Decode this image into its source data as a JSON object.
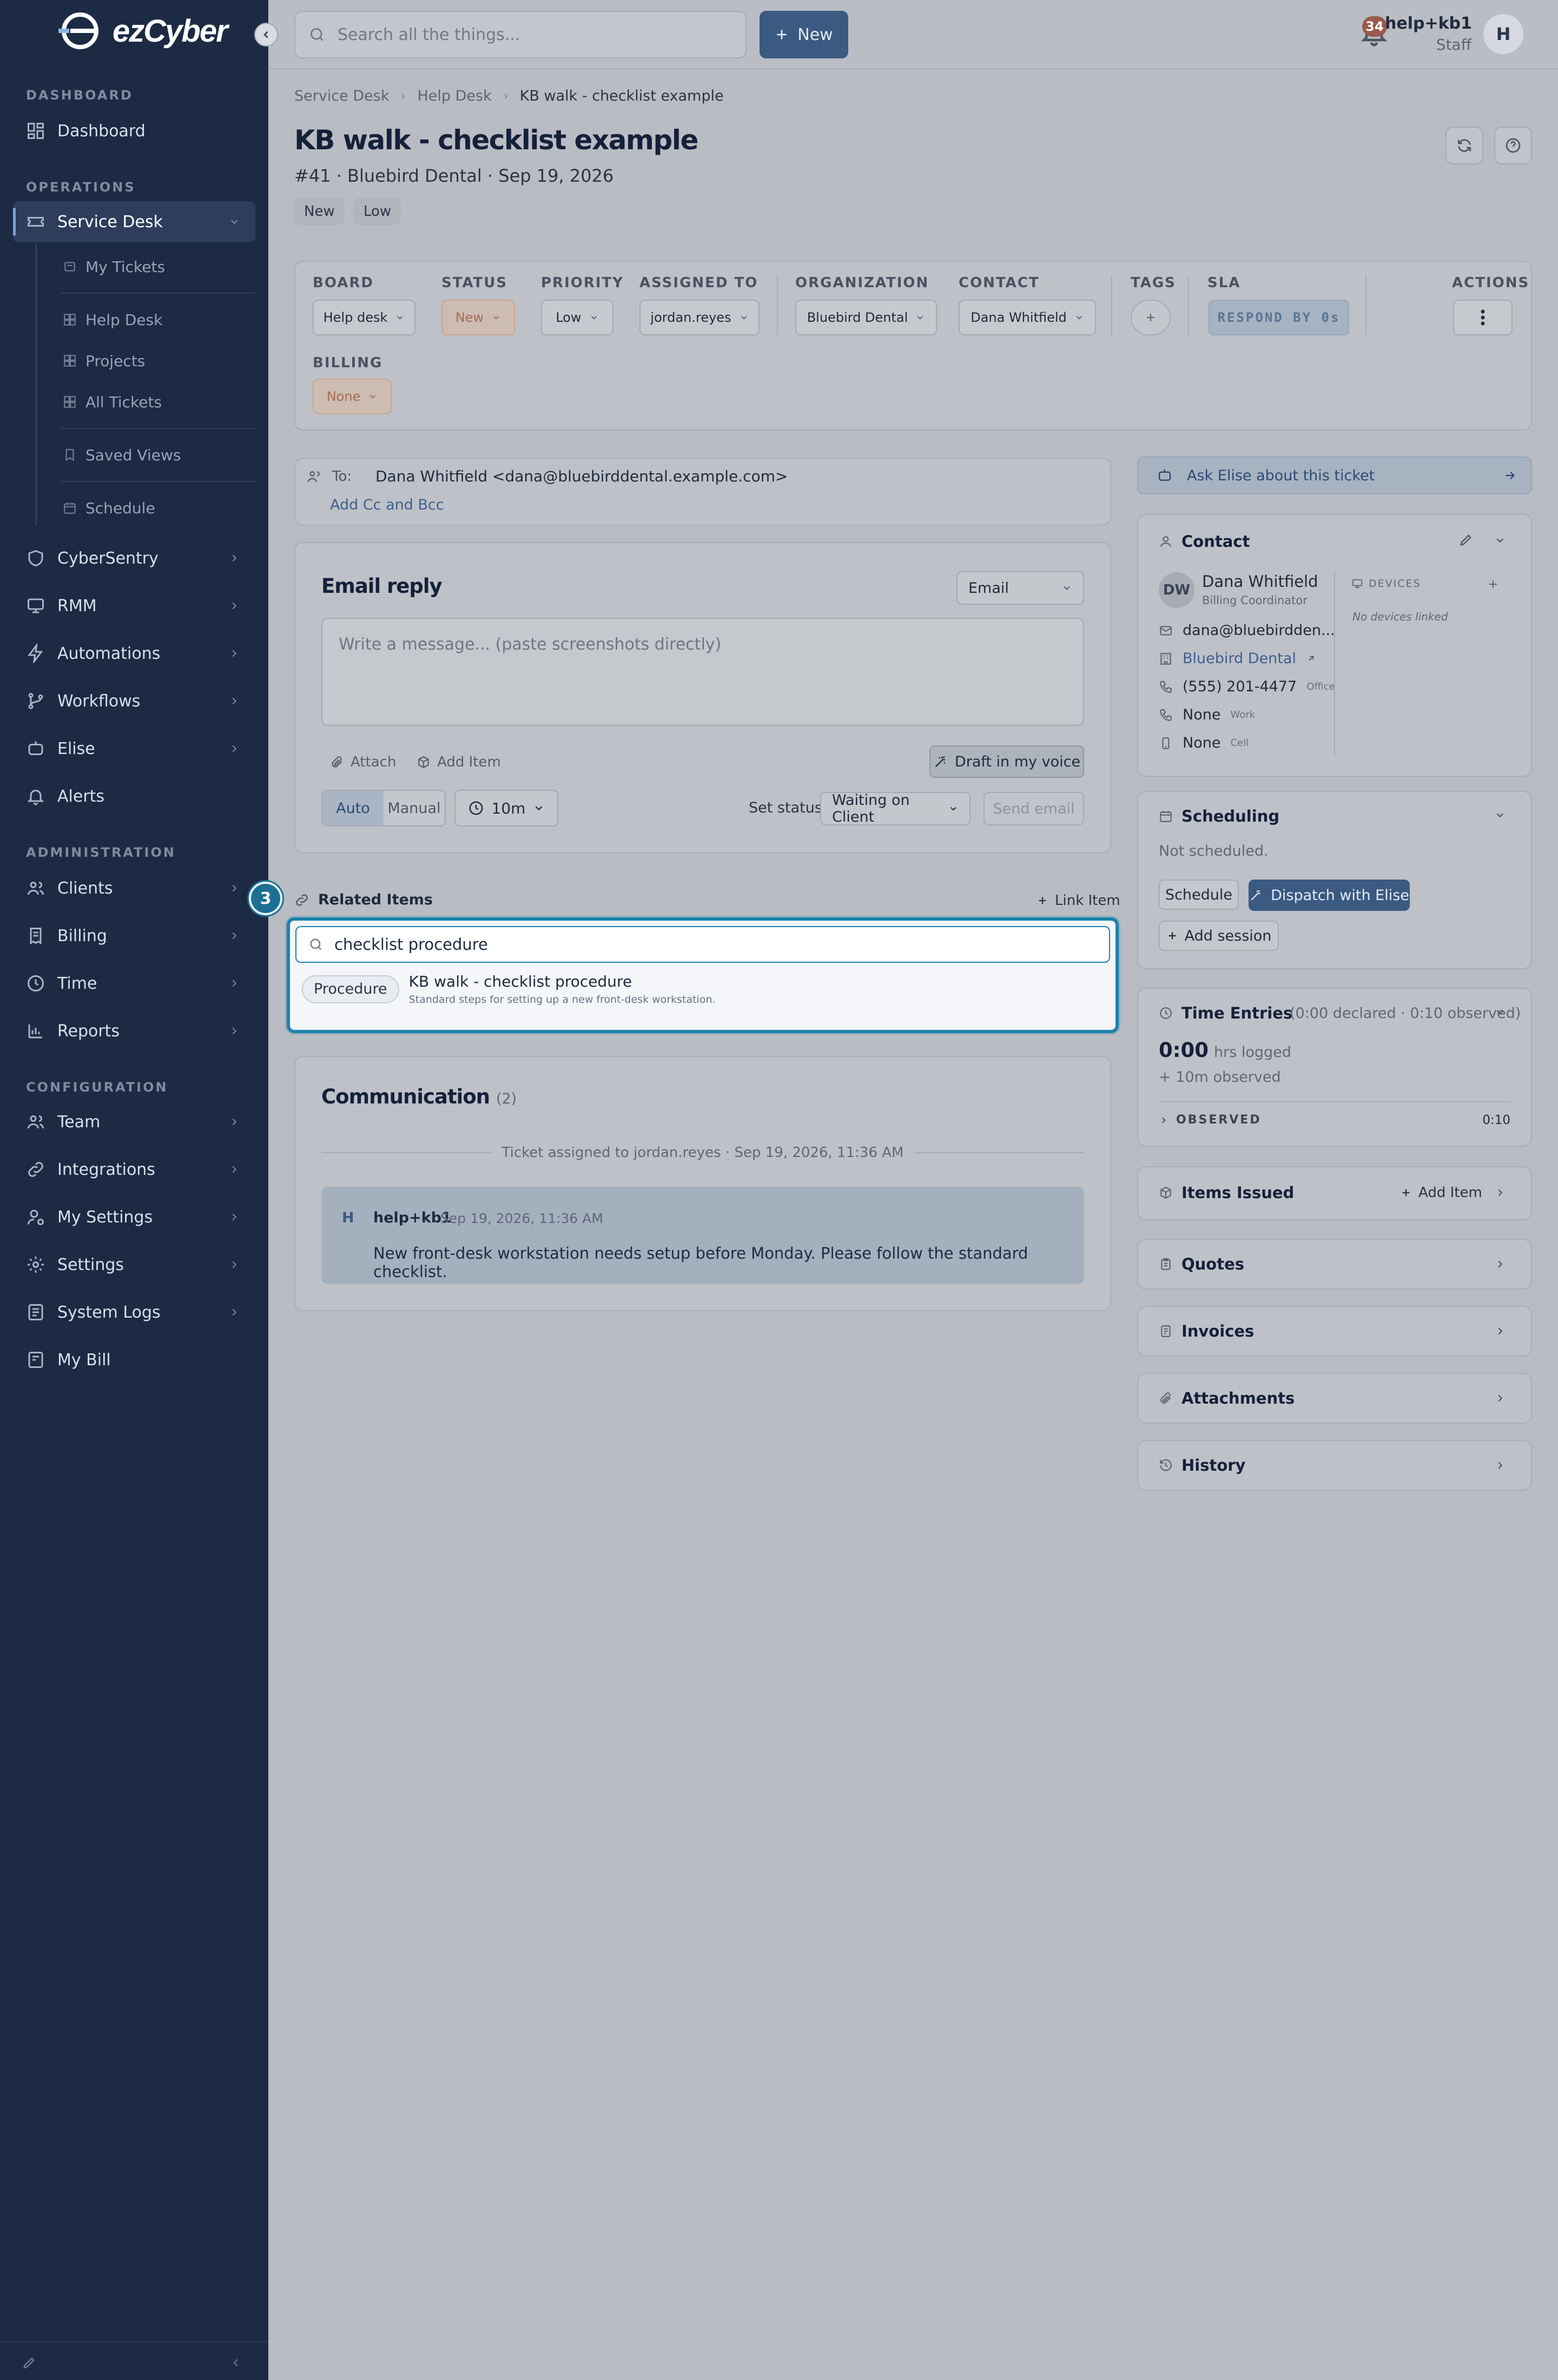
{
  "app": {
    "logo_text": "ezCyber"
  },
  "sidebar": {
    "sections": {
      "dashboard": "DASHBOARD",
      "operations": "OPERATIONS",
      "administration": "ADMINISTRATION",
      "configuration": "CONFIGURATION"
    },
    "dashboard": "Dashboard",
    "service_desk": "Service Desk",
    "sub": {
      "my_tickets": "My Tickets",
      "help_desk": "Help Desk",
      "projects": "Projects",
      "all_tickets": "All Tickets",
      "saved_views": "Saved Views",
      "schedule": "Schedule"
    },
    "ops": [
      "CyberSentry",
      "RMM",
      "Automations",
      "Workflows",
      "Elise",
      "Alerts"
    ],
    "admin": [
      "Clients",
      "Billing",
      "Time",
      "Reports"
    ],
    "config": [
      "Team",
      "Integrations",
      "My Settings",
      "Settings",
      "System Logs",
      "My Bill"
    ]
  },
  "topbar": {
    "search_placeholder": "Search all the things...",
    "new_label": "New",
    "notif_count": "34",
    "user_name": "help+kb1",
    "user_role": "Staff",
    "avatar_initial": "H"
  },
  "breadcrumb": [
    "Service Desk",
    "Help Desk",
    "KB walk - checklist example"
  ],
  "ticket": {
    "title": "KB walk - checklist example",
    "subtitle": "#41 · Bluebird Dental · Sep 19, 2026",
    "pills": [
      "New",
      "Low"
    ]
  },
  "fields": {
    "board": {
      "label": "BOARD",
      "value": "Help desk"
    },
    "status": {
      "label": "STATUS",
      "value": "New"
    },
    "priority": {
      "label": "PRIORITY",
      "value": "Low"
    },
    "assigned": {
      "label": "ASSIGNED TO",
      "value": "jordan.reyes"
    },
    "organization": {
      "label": "ORGANIZATION",
      "value": "Bluebird Dental"
    },
    "contact": {
      "label": "CONTACT",
      "value": "Dana Whitfield"
    },
    "tags": {
      "label": "TAGS"
    },
    "sla": {
      "label": "SLA",
      "value": "RESPOND BY 0s"
    },
    "actions": {
      "label": "ACTIONS"
    },
    "billing": {
      "label": "BILLING",
      "value": "None"
    }
  },
  "email": {
    "to_label": "To:",
    "to_value": "Dana Whitfield <dana@bluebirddental.example.com>",
    "add_cc": "Add Cc and Bcc",
    "title": "Email reply",
    "channel": "Email",
    "placeholder": "Write a message... (paste screenshots directly)",
    "attach": "Attach",
    "add_item": "Add Item",
    "draft": "Draft in my voice",
    "mode_auto": "Auto",
    "mode_manual": "Manual",
    "timer": "10m",
    "set_status_label": "Set status",
    "status_value": "Waiting on Client",
    "send": "Send email"
  },
  "related": {
    "title": "Related Items",
    "link_item": "Link Item",
    "step": "3",
    "search_value": "checklist procedure",
    "result": {
      "type": "Procedure",
      "title": "KB walk - checklist procedure",
      "desc": "Standard steps for setting up a new front-desk workstation."
    }
  },
  "communication": {
    "title": "Communication",
    "count": "(2)",
    "event": "Ticket assigned to jordan.reyes · Sep 19, 2026, 11:36 AM",
    "message": {
      "initial": "H",
      "author": "help+kb1",
      "time": "Sep 19, 2026, 11:36 AM",
      "body": "New front-desk workstation needs setup before Monday. Please follow the standard checklist."
    }
  },
  "right": {
    "ask_elise": "Ask Elise about this ticket",
    "contact": {
      "title": "Contact",
      "initials": "DW",
      "name": "Dana Whitfield",
      "role": "Billing Coordinator",
      "devices_label": "DEVICES",
      "no_devices": "No devices linked",
      "email": "dana@bluebirdden...",
      "org": "Bluebird Dental",
      "phone": "(555) 201-4477",
      "phone_type": "Office",
      "work": "None",
      "work_type": "Work",
      "cell": "None",
      "cell_type": "Cell"
    },
    "scheduling": {
      "title": "Scheduling",
      "status": "Not scheduled.",
      "schedule": "Schedule",
      "dispatch": "Dispatch with Elise",
      "add_session": "Add session"
    },
    "time": {
      "title": "Time Entries",
      "summary": "(0:00 declared · 0:10 observed)",
      "hours": "0:00",
      "hours_label": "hrs logged",
      "observed_line": "+ 10m observed",
      "observed_label": "OBSERVED",
      "observed_value": "0:10"
    },
    "items_issued": {
      "title": "Items Issued",
      "add": "Add Item"
    },
    "quotes": "Quotes",
    "invoices": "Invoices",
    "attachments": "Attachments",
    "history": "History"
  },
  "colors": {
    "sidebar": "#1c2a44",
    "accent": "#3b5a82",
    "highlight": "#1b82ab",
    "warm": "#a76a50"
  }
}
